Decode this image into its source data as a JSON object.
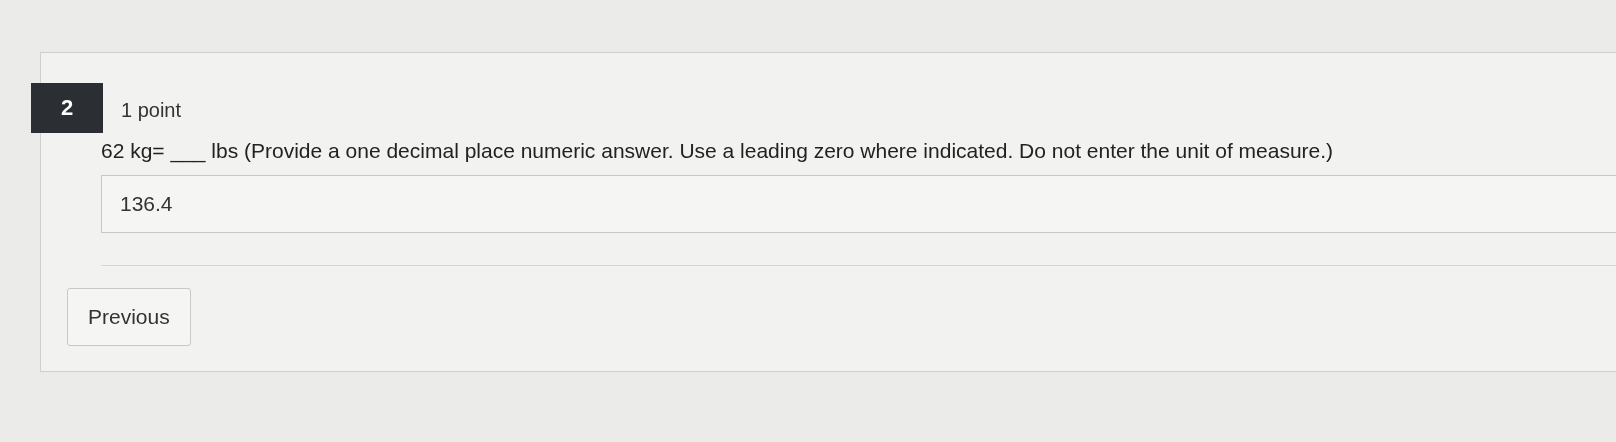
{
  "question": {
    "number": "2",
    "points": "1 point",
    "text": "62 kg= ___ lbs (Provide a one decimal place numeric answer. Use a leading zero where indicated. Do not enter the unit of measure.)",
    "answer": "136.4"
  },
  "buttons": [
    "Previous"
  ]
}
